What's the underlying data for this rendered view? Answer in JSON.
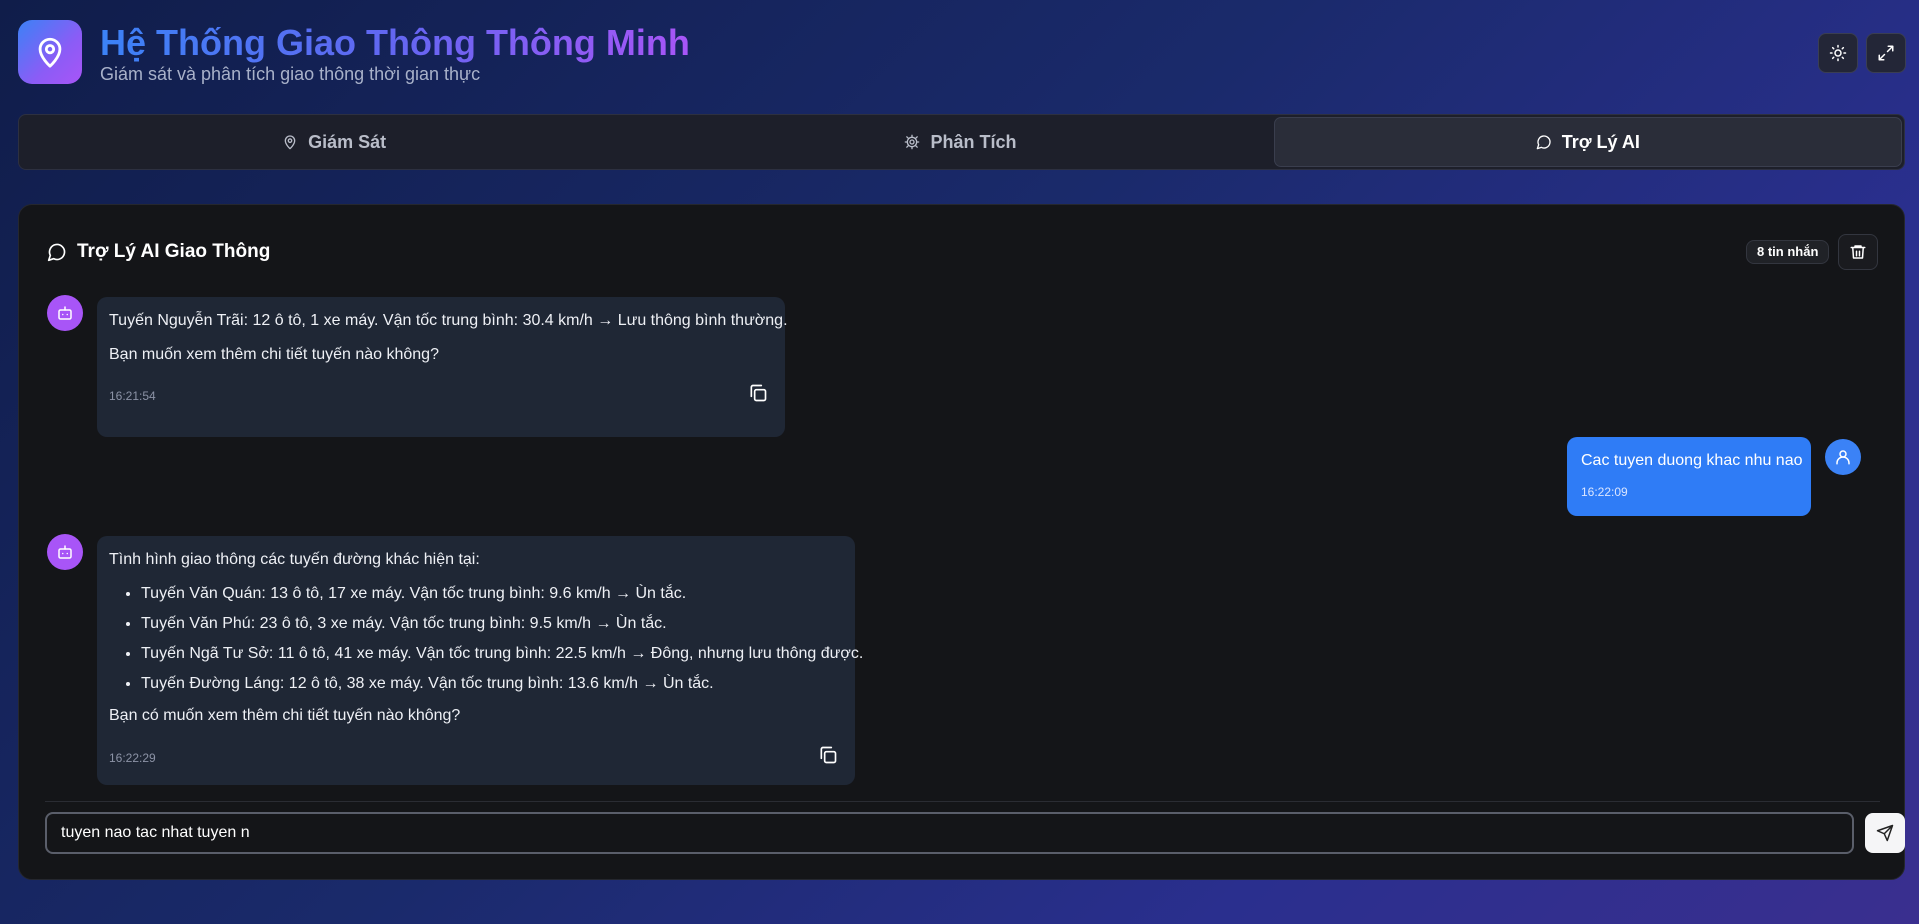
{
  "header": {
    "title": "Hệ Thống Giao Thông Thông Minh",
    "subtitle": "Giám sát và phân tích giao thông thời gian thực",
    "logo_icon": "map-pin-icon",
    "buttons": [
      "theme-icon",
      "fullscreen-icon"
    ]
  },
  "tabs": [
    {
      "label": "Giám Sát",
      "icon": "map-pin-icon",
      "active": false
    },
    {
      "label": "Phân Tích",
      "icon": "settings-icon",
      "active": false
    },
    {
      "label": "Trợ Lý AI",
      "icon": "chat-icon",
      "active": true
    }
  ],
  "chat": {
    "title": "Trợ Lý AI Giao Thông",
    "message_count": "8 tin nhắn",
    "messages": [
      {
        "role": "bot",
        "paragraphs": [
          "Tuyến Nguyễn Trãi: 12 ô tô, 1 xe máy. Vận tốc trung bình: 30.4 km/h → Lưu thông bình thường.",
          "Bạn muốn xem thêm chi tiết tuyến nào không?"
        ],
        "time": "16:21:54"
      },
      {
        "role": "user",
        "text": "Cac tuyen duong khac nhu nao",
        "time": "16:22:09"
      },
      {
        "role": "bot",
        "intro": "Tình hình giao thông các tuyến đường khác hiện tại:",
        "items": [
          "Tuyến Văn Quán: 13 ô tô, 17 xe máy. Vận tốc trung bình: 9.6 km/h → Ùn tắc.",
          "Tuyến Văn Phú: 23 ô tô, 3 xe máy. Vận tốc trung bình: 9.5 km/h → Ùn tắc.",
          "Tuyến Ngã Tư Sở: 11 ô tô, 41 xe máy. Vận tốc trung bình: 22.5 km/h → Đông, nhưng lưu thông được.",
          "Tuyến Đường Láng: 12 ô tô, 38 xe máy. Vận tốc trung bình: 13.6 km/h → Ùn tắc."
        ],
        "outro": "Bạn có muốn xem thêm chi tiết tuyến nào không?",
        "time": "16:22:29"
      }
    ],
    "input_value": "tuyen nao tac nhat tuyen n"
  },
  "colors": {
    "accent_blue": "#3b82f6",
    "accent_purple": "#a855f7",
    "user_bubble": "#2f7cf6",
    "bot_bubble": "#1f2735"
  }
}
